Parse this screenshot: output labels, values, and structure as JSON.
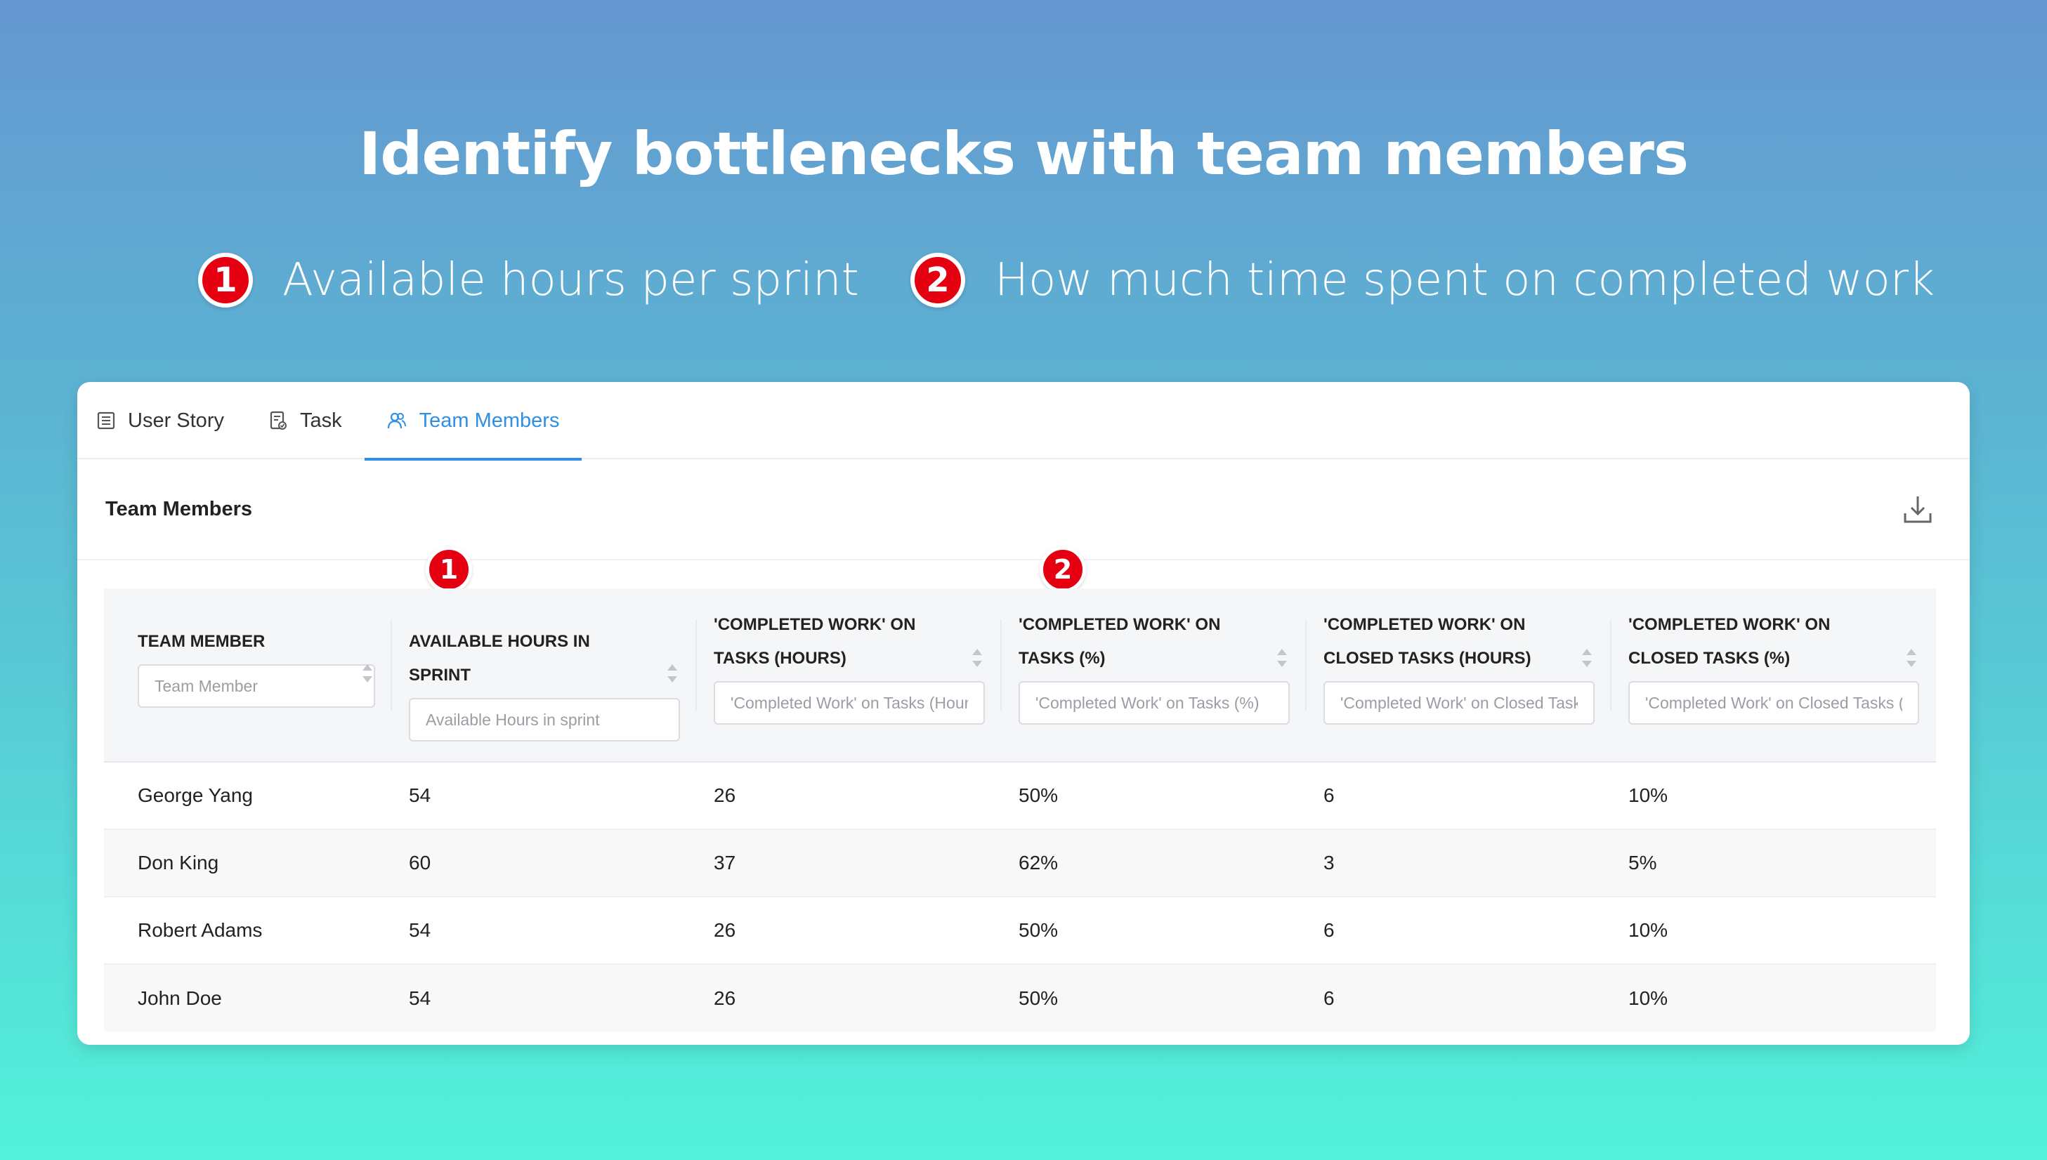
{
  "hero": {
    "title": "Identify bottlenecks with team members",
    "features": [
      {
        "num": "1",
        "text": "Available hours per sprint"
      },
      {
        "num": "2",
        "text": "How much time spent on completed work"
      }
    ]
  },
  "tabs": [
    {
      "label": "User Story",
      "icon": "list-icon"
    },
    {
      "label": "Task",
      "icon": "task-icon"
    },
    {
      "label": "Team Members",
      "icon": "team-icon",
      "active": true
    }
  ],
  "section": {
    "title": "Team Members",
    "download_icon": "download-icon"
  },
  "markers": [
    "1",
    "2"
  ],
  "table": {
    "columns": [
      {
        "label": "TEAM MEMBER",
        "placeholder": "Team Member"
      },
      {
        "label": "AVAILABLE HOURS IN SPRINT",
        "placeholder": "Available Hours in sprint"
      },
      {
        "label": "'COMPLETED WORK' ON TASKS (HOURS)",
        "placeholder": "'Completed Work' on Tasks (Hours)"
      },
      {
        "label": "'COMPLETED WORK' ON TASKS (%)",
        "placeholder": "'Completed Work' on Tasks (%)"
      },
      {
        "label": "'COMPLETED WORK' ON CLOSED TASKS (HOURS)",
        "placeholder": "'Completed Work' on Closed Tasks (Hours)"
      },
      {
        "label": "'COMPLETED WORK' ON CLOSED TASKS (%)",
        "placeholder": "'Completed Work' on Closed Tasks (%)"
      }
    ],
    "rows": [
      [
        "George Yang",
        "54",
        "26",
        "50%",
        "6",
        "10%"
      ],
      [
        "Don King",
        "60",
        "37",
        "62%",
        "3",
        "5%"
      ],
      [
        "Robert Adams",
        "54",
        "26",
        "50%",
        "6",
        "10%"
      ],
      [
        "John Doe",
        "54",
        "26",
        "50%",
        "6",
        "10%"
      ]
    ]
  },
  "colors": {
    "accent": "#2f8fe6",
    "badge": "#e40010"
  }
}
